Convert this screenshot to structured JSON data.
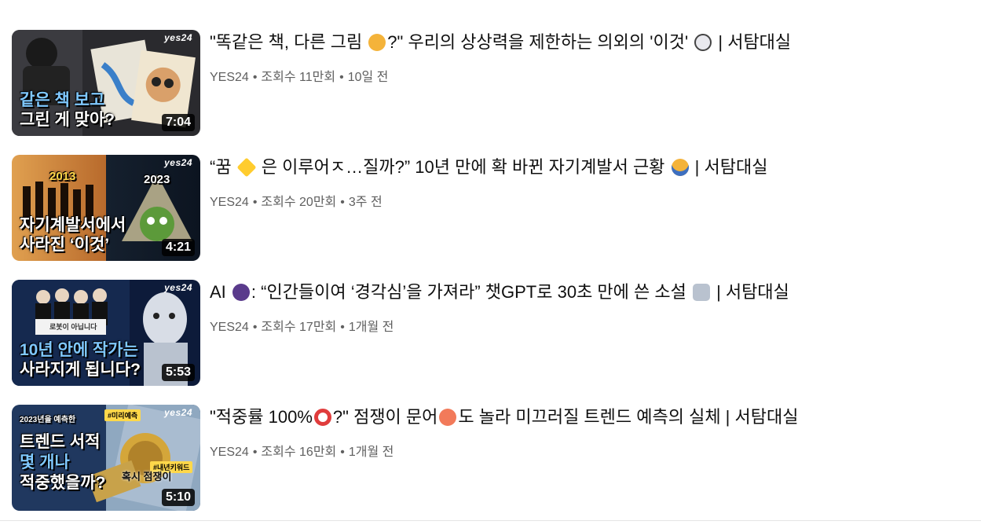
{
  "videos": [
    {
      "title": "\"똑같은 책, 다른 그림 ",
      "title_after_emoji": "?\" 우리의 상상력을 제한하는 의외의 '이것' ",
      "title_tail": " | 서탐대실",
      "emoji1": "thinking-face-icon",
      "emoji2": "eyes-icon",
      "channel": "YES24",
      "views": "조회수 11만회",
      "age": "10일 전",
      "duration": "7:04",
      "thumb_mark": "yes24",
      "thumb_line1": "같은 책 보고",
      "thumb_line2": "그린 게 맞아?"
    },
    {
      "title": "“꿈 ",
      "title_after_emoji": " 은 이루어ㅈ…질까?” 10년 만에 확 바뀐 자기계발서 근황 ",
      "title_tail": " | 서탐대실",
      "emoji1": "star-icon",
      "emoji2": "screaming-face-icon",
      "channel": "YES24",
      "views": "조회수 20만회",
      "age": "3주 전",
      "duration": "4:21",
      "thumb_mark": "yes24",
      "thumb_year1": "2013",
      "thumb_year2": "2023",
      "thumb_line1": "자기계발서에서",
      "thumb_line2": "사라진 ‘이것’"
    },
    {
      "title": "AI ",
      "title_after_emoji": ": “인간들이여 ‘경각심’을 가져라” 챗GPT로 30초 만에 쓴 소설 ",
      "title_tail": " | 서탐대실",
      "emoji1": "speaking-head-icon",
      "emoji2": "robot-icon",
      "channel": "YES24",
      "views": "조회수 17만회",
      "age": "1개월 전",
      "duration": "5:53",
      "thumb_mark": "yes24",
      "thumb_caption": "로봇이 아닙니다",
      "thumb_line1": "10년 안에 작가는",
      "thumb_line2": "사라지게 됩니다?"
    },
    {
      "title": "\"적중률 100%",
      "title_after_emoji": "?\" 점쟁이 문어",
      "title_tail": "도 놀라 미끄러질 트렌드 예측의 실체 | 서탐대실",
      "emoji1": "direct-hit-icon",
      "emoji2": "octopus-icon",
      "channel": "YES24",
      "views": "조회수 16만회",
      "age": "1개월 전",
      "duration": "5:10",
      "thumb_mark": "yes24",
      "thumb_tag1": "2023년을 예측한",
      "thumb_tag2": "#미리예측",
      "thumb_tag3": "#내년키워드",
      "thumb_line1": "트렌드 서적",
      "thumb_line2": "몇 개나",
      "thumb_line3": "적중했을까?",
      "thumb_side": "혹시 점쟁이"
    }
  ],
  "separator": "•",
  "colors": {
    "title": "#0f0f0f",
    "meta": "#606060",
    "duration_bg": "#000000"
  }
}
